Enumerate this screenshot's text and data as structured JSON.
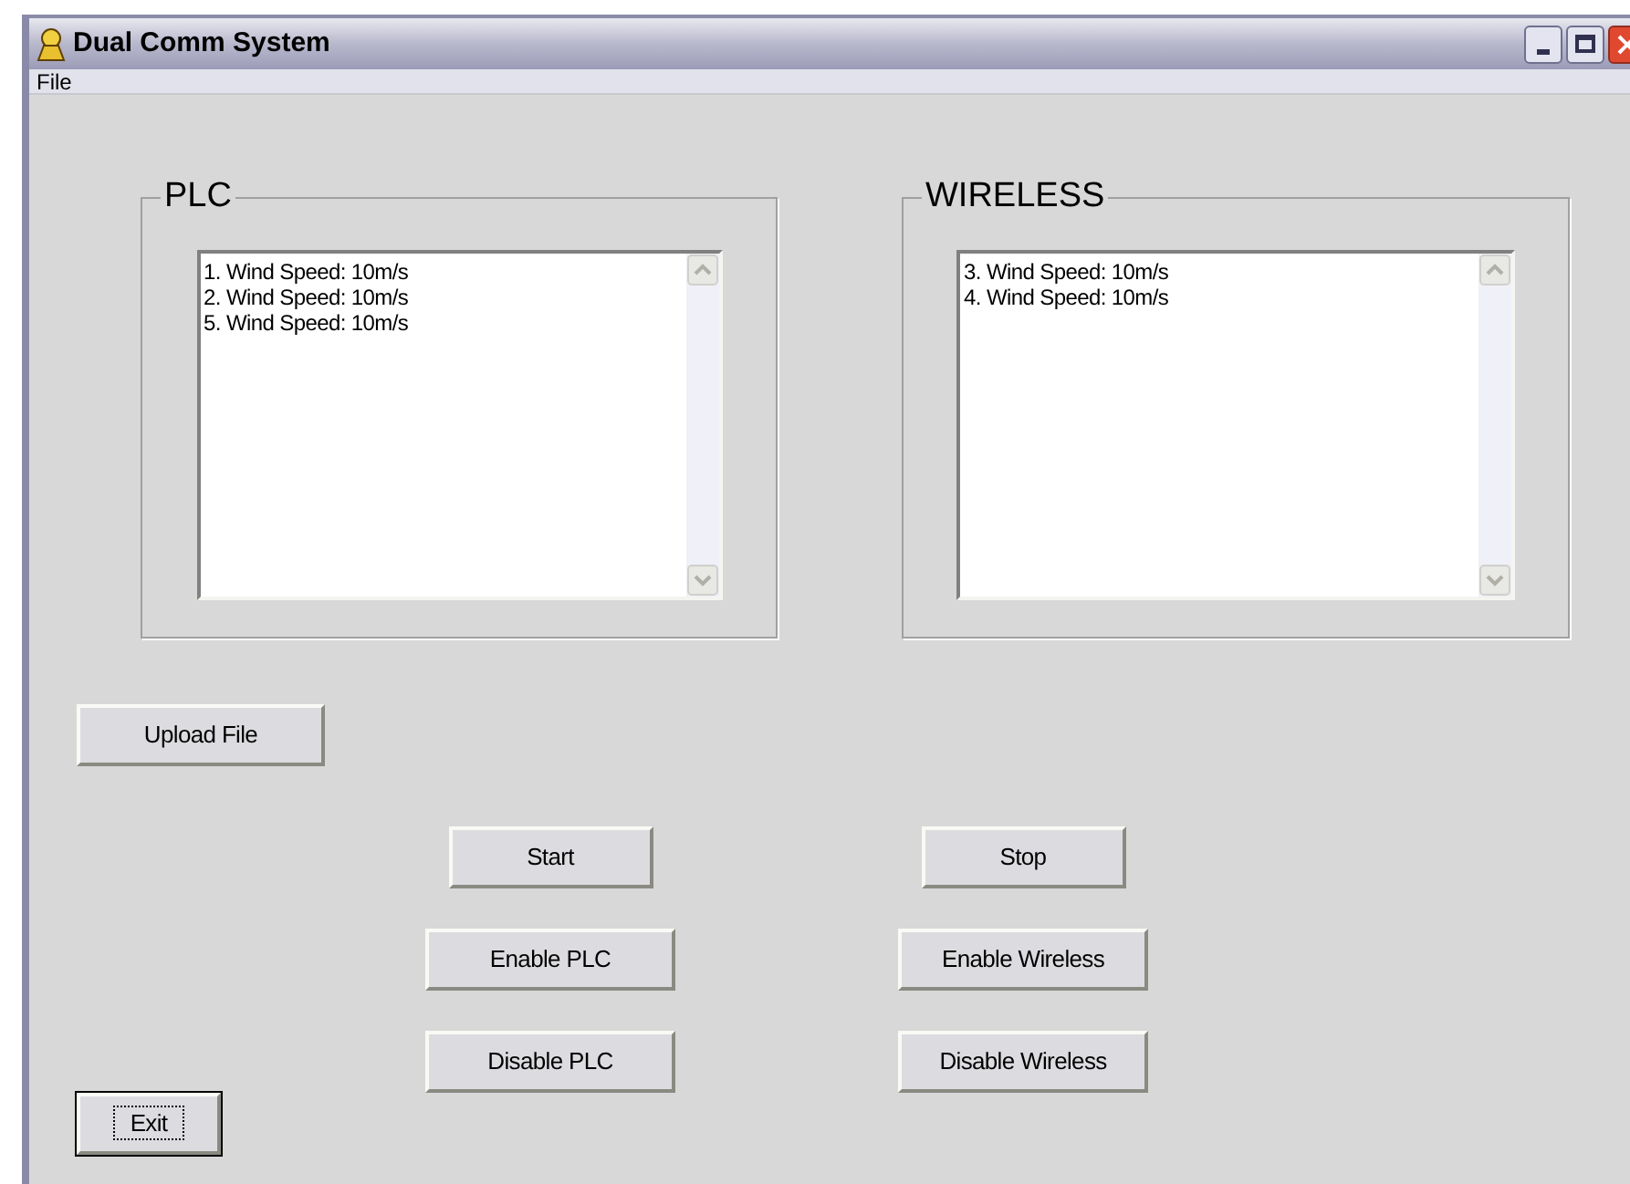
{
  "window": {
    "title": "Dual Comm System"
  },
  "menu": [
    {
      "label": "File"
    }
  ],
  "groups": [
    {
      "title": "PLC",
      "items": [
        "1. Wind Speed: 10m/s",
        "2. Wind Speed: 10m/s",
        "5. Wind Speed: 10m/s"
      ]
    },
    {
      "title": "WIRELESS",
      "items": [
        "3. Wind Speed: 10m/s",
        "4. Wind Speed: 10m/s"
      ]
    }
  ],
  "upload_button": {
    "label": "Upload File",
    "focused": false
  },
  "control_columns": [
    [
      {
        "label": "Start",
        "focused": false
      },
      {
        "label": "Enable PLC",
        "focused": false
      },
      {
        "label": "Disable PLC",
        "focused": false
      }
    ],
    [
      {
        "label": "Stop",
        "focused": false
      },
      {
        "label": "Enable Wireless",
        "focused": false
      },
      {
        "label": "Disable Wireless",
        "focused": false
      }
    ]
  ],
  "exit_button": {
    "label": "Exit",
    "focused": true
  }
}
